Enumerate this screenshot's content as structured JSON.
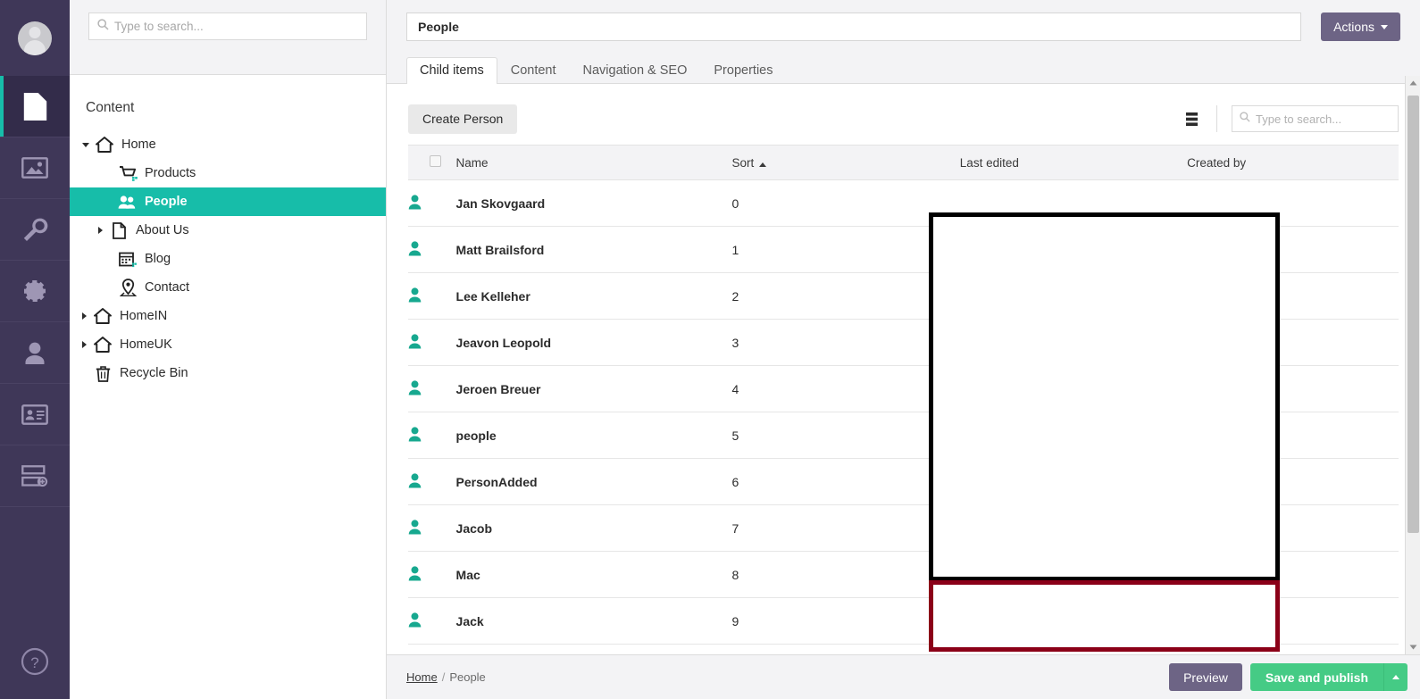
{
  "rail": {
    "avatar_name": "user-avatar",
    "items": [
      {
        "name": "content",
        "icon": "document-icon",
        "active": true
      },
      {
        "name": "media",
        "icon": "image-icon",
        "active": false
      },
      {
        "name": "settings",
        "icon": "wrench-icon",
        "active": false
      },
      {
        "name": "packages",
        "icon": "gear-icon",
        "active": false
      },
      {
        "name": "users",
        "icon": "user-icon",
        "active": false
      },
      {
        "name": "members",
        "icon": "member-card-icon",
        "active": false
      },
      {
        "name": "forms",
        "icon": "forms-icon",
        "active": false
      }
    ],
    "help_icon": "question-mark-icon"
  },
  "tree_panel": {
    "search": {
      "placeholder": "Type to search...",
      "value": "",
      "icon": "search-icon"
    },
    "title": "Content",
    "nodes": [
      {
        "label": "Home",
        "icon": "home-icon",
        "depth": 0,
        "caret": "down",
        "selected": false
      },
      {
        "label": "Products",
        "icon": "cart-icon",
        "depth": 1,
        "caret": "none",
        "selected": false
      },
      {
        "label": "People",
        "icon": "people-icon",
        "depth": 1,
        "caret": "none",
        "selected": true
      },
      {
        "label": "About Us",
        "icon": "document-icon",
        "depth": 1,
        "caret": "right",
        "selected": false
      },
      {
        "label": "Blog",
        "icon": "calendar-icon",
        "depth": 1,
        "caret": "none",
        "selected": false
      },
      {
        "label": "Contact",
        "icon": "map-pin-icon",
        "depth": 1,
        "caret": "none",
        "selected": false
      },
      {
        "label": "HomeIN",
        "icon": "home-icon",
        "depth": 0,
        "caret": "right",
        "selected": false
      },
      {
        "label": "HomeUK",
        "icon": "home-icon",
        "depth": 0,
        "caret": "right",
        "selected": false
      },
      {
        "label": "Recycle Bin",
        "icon": "trash-icon",
        "depth": 0,
        "caret": "none",
        "selected": false
      }
    ]
  },
  "header": {
    "name_value": "People",
    "actions_label": "Actions",
    "actions_caret_icon": "chevron-down-icon"
  },
  "tabs": [
    {
      "label": "Child items",
      "active": true
    },
    {
      "label": "Content",
      "active": false
    },
    {
      "label": "Navigation & SEO",
      "active": false
    },
    {
      "label": "Properties",
      "active": false
    }
  ],
  "toolbar": {
    "create_label": "Create Person",
    "layout_icon": "list-view-icon",
    "search": {
      "placeholder": "Type to search...",
      "value": "",
      "icon": "search-icon"
    }
  },
  "table": {
    "columns": [
      {
        "key": "name",
        "label": "Name",
        "sorted": false
      },
      {
        "key": "sort",
        "label": "Sort",
        "sorted": true,
        "direction": "asc"
      },
      {
        "key": "edited",
        "label": "Last edited",
        "sorted": false
      },
      {
        "key": "created",
        "label": "Created by",
        "sorted": false
      }
    ],
    "rows": [
      {
        "icon": "person-icon",
        "name": "Jan Skovgaard",
        "sort": "0",
        "edited": "",
        "created": ""
      },
      {
        "icon": "person-icon",
        "name": "Matt Brailsford",
        "sort": "1",
        "edited": "",
        "created": ""
      },
      {
        "icon": "person-icon",
        "name": "Lee Kelleher",
        "sort": "2",
        "edited": "",
        "created": ""
      },
      {
        "icon": "person-icon",
        "name": "Jeavon Leopold",
        "sort": "3",
        "edited": "",
        "created": ""
      },
      {
        "icon": "person-icon",
        "name": "Jeroen Breuer",
        "sort": "4",
        "edited": "",
        "created": ""
      },
      {
        "icon": "person-icon",
        "name": "people",
        "sort": "5",
        "edited": "",
        "created": ""
      },
      {
        "icon": "person-icon",
        "name": "PersonAdded",
        "sort": "6",
        "edited": "",
        "created": ""
      },
      {
        "icon": "person-icon",
        "name": "Jacob",
        "sort": "7",
        "edited": "",
        "created": ""
      },
      {
        "icon": "person-icon",
        "name": "Mac",
        "sort": "8",
        "edited": "",
        "created": ""
      },
      {
        "icon": "person-icon",
        "name": "Jack",
        "sort": "9",
        "edited": "",
        "created": ""
      }
    ]
  },
  "footer": {
    "breadcrumb": [
      {
        "label": "Home",
        "link": true
      },
      {
        "label": "People",
        "link": false
      }
    ],
    "separator": "/",
    "preview_label": "Preview",
    "publish_label": "Save and publish",
    "publish_caret_icon": "chevron-up-icon"
  },
  "colors": {
    "rail_bg": "#3f3758",
    "rail_active_bg": "#332c4a",
    "accent_teal": "#17bda9",
    "actions_purple": "#6d6485",
    "publish_green": "#45cb85",
    "annotation_black": "#000000",
    "annotation_red": "#8b0018"
  }
}
